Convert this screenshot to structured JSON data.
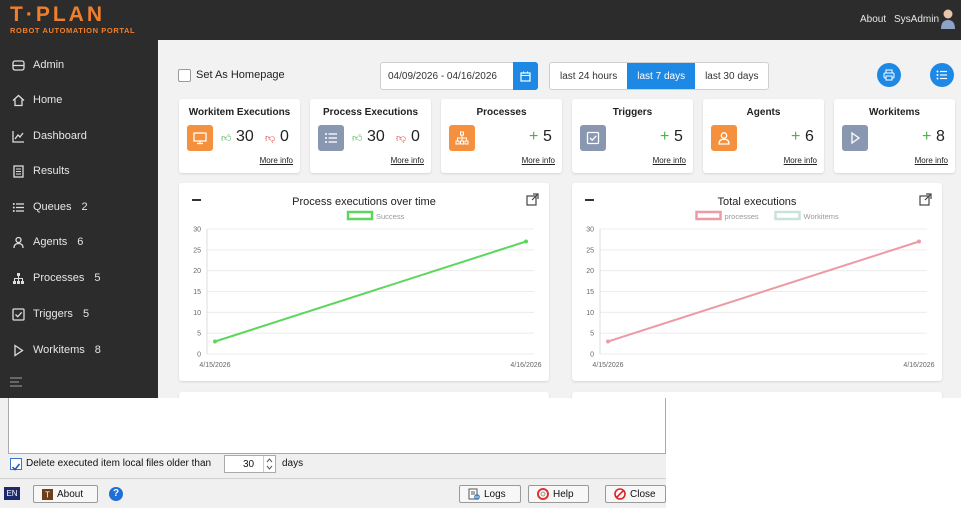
{
  "header": {
    "logo_main": "T·PLAN",
    "logo_sub": "ROBOT AUTOMATION PORTAL",
    "about_link": "About",
    "user_name": "SysAdmin"
  },
  "sidebar": {
    "items": [
      {
        "label": "Admin",
        "count": "",
        "icon": "admin-icon"
      },
      {
        "label": "Home",
        "count": "",
        "icon": "home-icon"
      },
      {
        "label": "Dashboard",
        "count": "",
        "icon": "dashboard-icon"
      },
      {
        "label": "Results",
        "count": "",
        "icon": "results-icon"
      },
      {
        "label": "Queues",
        "count": "2",
        "icon": "queues-icon"
      },
      {
        "label": "Agents",
        "count": "6",
        "icon": "agents-icon"
      },
      {
        "label": "Processes",
        "count": "5",
        "icon": "processes-icon"
      },
      {
        "label": "Triggers",
        "count": "5",
        "icon": "triggers-icon"
      },
      {
        "label": "Workitems",
        "count": "8",
        "icon": "workitems-icon"
      }
    ]
  },
  "toolbar": {
    "homepage_label": "Set As Homepage",
    "date_range": "04/09/2026 - 04/16/2026",
    "ranges": [
      {
        "label": "last 24 hours",
        "active": false
      },
      {
        "label": "last 7 days",
        "active": true
      },
      {
        "label": "last 30 days",
        "active": false
      }
    ]
  },
  "cards": [
    {
      "title": "Workitem Executions",
      "icon": "monitor-icon",
      "color": "#f5913e",
      "up": "30",
      "down": "0",
      "more": "More info"
    },
    {
      "title": "Process Executions",
      "icon": "list-icon",
      "color": "#8a97b0",
      "up": "30",
      "down": "0",
      "more": "More info"
    },
    {
      "title": "Processes",
      "icon": "sitemap-icon",
      "color": "#f5913e",
      "plus": "+",
      "value": "5",
      "more": "More info"
    },
    {
      "title": "Triggers",
      "icon": "checkbox-icon",
      "color": "#8a97b0",
      "plus": "+",
      "value": "5",
      "more": "More info"
    },
    {
      "title": "Agents",
      "icon": "user-icon",
      "color": "#f5913e",
      "plus": "+",
      "value": "6",
      "more": "More info"
    },
    {
      "title": "Workitems",
      "icon": "play-icon",
      "color": "#8a97b0",
      "plus": "+",
      "value": "8",
      "more": "More info"
    }
  ],
  "chart_data": [
    {
      "type": "line",
      "title": "Process executions over time",
      "x": [
        "4/15/2026",
        "4/16/2026"
      ],
      "series": [
        {
          "name": "Success",
          "values": [
            3,
            27
          ],
          "color": "#5cd65c"
        }
      ],
      "ylim": [
        0,
        30
      ],
      "yticks": [
        0,
        5,
        10,
        15,
        20,
        25,
        30
      ],
      "legend": "top"
    },
    {
      "type": "line",
      "title": "Total executions",
      "x": [
        "4/15/2026",
        "4/16/2026"
      ],
      "series": [
        {
          "name": "processes",
          "values": [
            3,
            27
          ],
          "color": "#ec9ba5"
        },
        {
          "name": "Workitems",
          "values": [],
          "color": "#c9e3dc"
        }
      ],
      "ylim": [
        0,
        30
      ],
      "yticks": [
        0,
        5,
        10,
        15,
        20,
        25,
        30
      ],
      "legend": "top"
    }
  ],
  "dialog": {
    "delete_label": "Delete executed item local files older than",
    "delete_checked": true,
    "days_value": "30",
    "days_label": "days",
    "lang": "EN",
    "about": "About",
    "logs": "Logs",
    "help": "Help",
    "close": "Close"
  }
}
